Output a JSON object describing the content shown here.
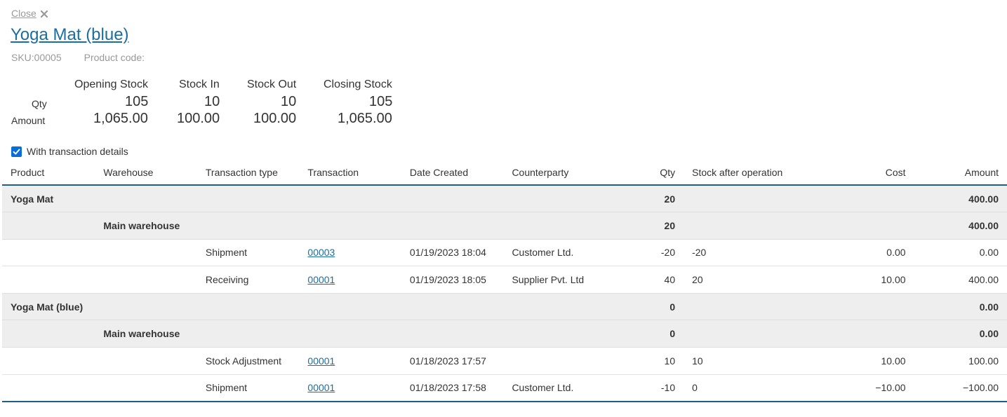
{
  "header": {
    "close_label": "Close",
    "close_icon": "close-icon",
    "title": "Yoga Mat (blue)",
    "sku": "SKU:00005",
    "product_code": "Product code:"
  },
  "summary": {
    "columns": [
      "Opening Stock",
      "Stock In",
      "Stock Out",
      "Closing Stock"
    ],
    "qty_label": "Qty",
    "amount_label": "Amount",
    "qty": [
      "105",
      "10",
      "10",
      "105"
    ],
    "amount": [
      "1,065.00",
      "100.00",
      "100.00",
      "1,065.00"
    ]
  },
  "options": {
    "with_details_label": "With transaction details",
    "with_details_checked": true
  },
  "table": {
    "columns": [
      "Product",
      "Warehouse",
      "Transaction type",
      "Transaction",
      "Date Created",
      "Counterparty",
      "Qty",
      "Stock after operation",
      "Cost",
      "Amount"
    ],
    "rows": [
      {
        "kind": "group",
        "product": "Yoga Mat",
        "warehouse": "",
        "type": "",
        "transaction": "",
        "date": "",
        "counterparty": "",
        "qty": "20",
        "stock_after": "",
        "cost": "",
        "amount": "400.00"
      },
      {
        "kind": "group",
        "product": "",
        "warehouse": "Main warehouse",
        "type": "",
        "transaction": "",
        "date": "",
        "counterparty": "",
        "qty": "20",
        "stock_after": "",
        "cost": "",
        "amount": "400.00"
      },
      {
        "kind": "detail",
        "product": "",
        "warehouse": "",
        "type": "Shipment",
        "transaction": "00003",
        "date": "01/19/2023 18:04",
        "counterparty": "Customer Ltd.",
        "qty": "-20",
        "stock_after": "-20",
        "cost": "0.00",
        "amount": "0.00"
      },
      {
        "kind": "detail",
        "product": "",
        "warehouse": "",
        "type": "Receiving",
        "transaction": "00001",
        "date": "01/19/2023 18:05",
        "counterparty": "Supplier Pvt. Ltd",
        "qty": "40",
        "stock_after": "20",
        "cost": "10.00",
        "amount": "400.00"
      },
      {
        "kind": "group",
        "product": "Yoga Mat (blue)",
        "warehouse": "",
        "type": "",
        "transaction": "",
        "date": "",
        "counterparty": "",
        "qty": "0",
        "stock_after": "",
        "cost": "",
        "amount": "0.00"
      },
      {
        "kind": "group",
        "product": "",
        "warehouse": "Main warehouse",
        "type": "",
        "transaction": "",
        "date": "",
        "counterparty": "",
        "qty": "0",
        "stock_after": "",
        "cost": "",
        "amount": "0.00"
      },
      {
        "kind": "detail",
        "product": "",
        "warehouse": "",
        "type": "Stock Adjustment",
        "transaction": "00001",
        "date": "01/18/2023 17:57",
        "counterparty": "",
        "qty": "10",
        "stock_after": "10",
        "cost": "10.00",
        "amount": "100.00"
      },
      {
        "kind": "detail",
        "product": "",
        "warehouse": "",
        "type": "Shipment",
        "transaction": "00001",
        "date": "01/18/2023 17:58",
        "counterparty": "Customer Ltd.",
        "qty": "-10",
        "stock_after": "0",
        "cost": "−10.00",
        "amount": "−100.00"
      }
    ]
  },
  "colors": {
    "link": "#1a6ea0",
    "accent_border": "#1f5f86",
    "group_row_bg": "#eeeeee",
    "checkbox": "#0a6cd6"
  }
}
